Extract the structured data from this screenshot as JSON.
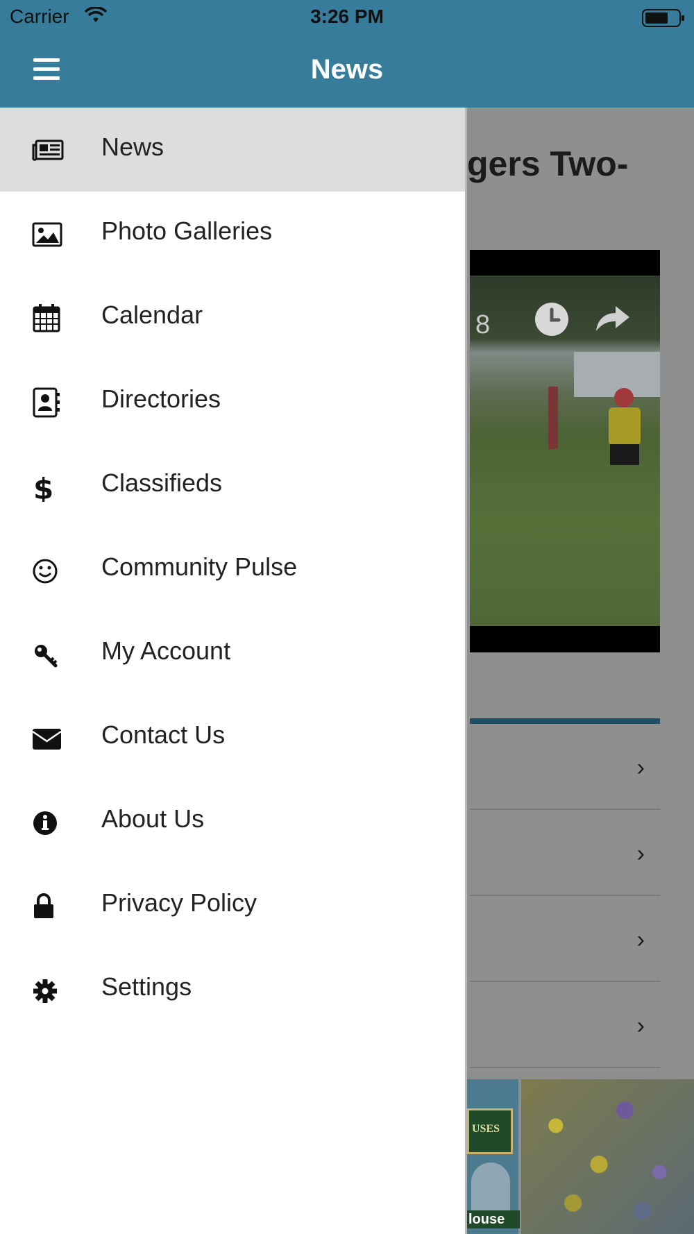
{
  "status_bar": {
    "carrier": "Carrier",
    "time": "3:26 PM"
  },
  "nav": {
    "title": "News"
  },
  "background": {
    "headline_fragment": "gers Two-",
    "photo_counter_fragment": "8",
    "list_rows": [
      "row-1",
      "row-2",
      "row-3",
      "row-4"
    ],
    "ad_label_fragment": "louse",
    "ad_sign_fragment": "USES"
  },
  "menu": {
    "items": [
      {
        "label": "News",
        "icon": "newspaper-icon",
        "active": true
      },
      {
        "label": "Photo Galleries",
        "icon": "image-icon"
      },
      {
        "label": "Calendar",
        "icon": "calendar-icon"
      },
      {
        "label": "Directories",
        "icon": "contact-book-icon"
      },
      {
        "label": "Classifieds",
        "icon": "dollar-icon"
      },
      {
        "label": "Community Pulse",
        "icon": "smiley-icon"
      },
      {
        "label": "My Account",
        "icon": "key-icon"
      },
      {
        "label": "Contact Us",
        "icon": "envelope-icon"
      },
      {
        "label": "About Us",
        "icon": "info-icon"
      },
      {
        "label": "Privacy Policy",
        "icon": "lock-icon"
      },
      {
        "label": "Settings",
        "icon": "gear-icon"
      }
    ]
  },
  "colors": {
    "nav_bar": "#377d9b",
    "active_item": "#dddddd",
    "section_bar": "#1f4f63"
  }
}
